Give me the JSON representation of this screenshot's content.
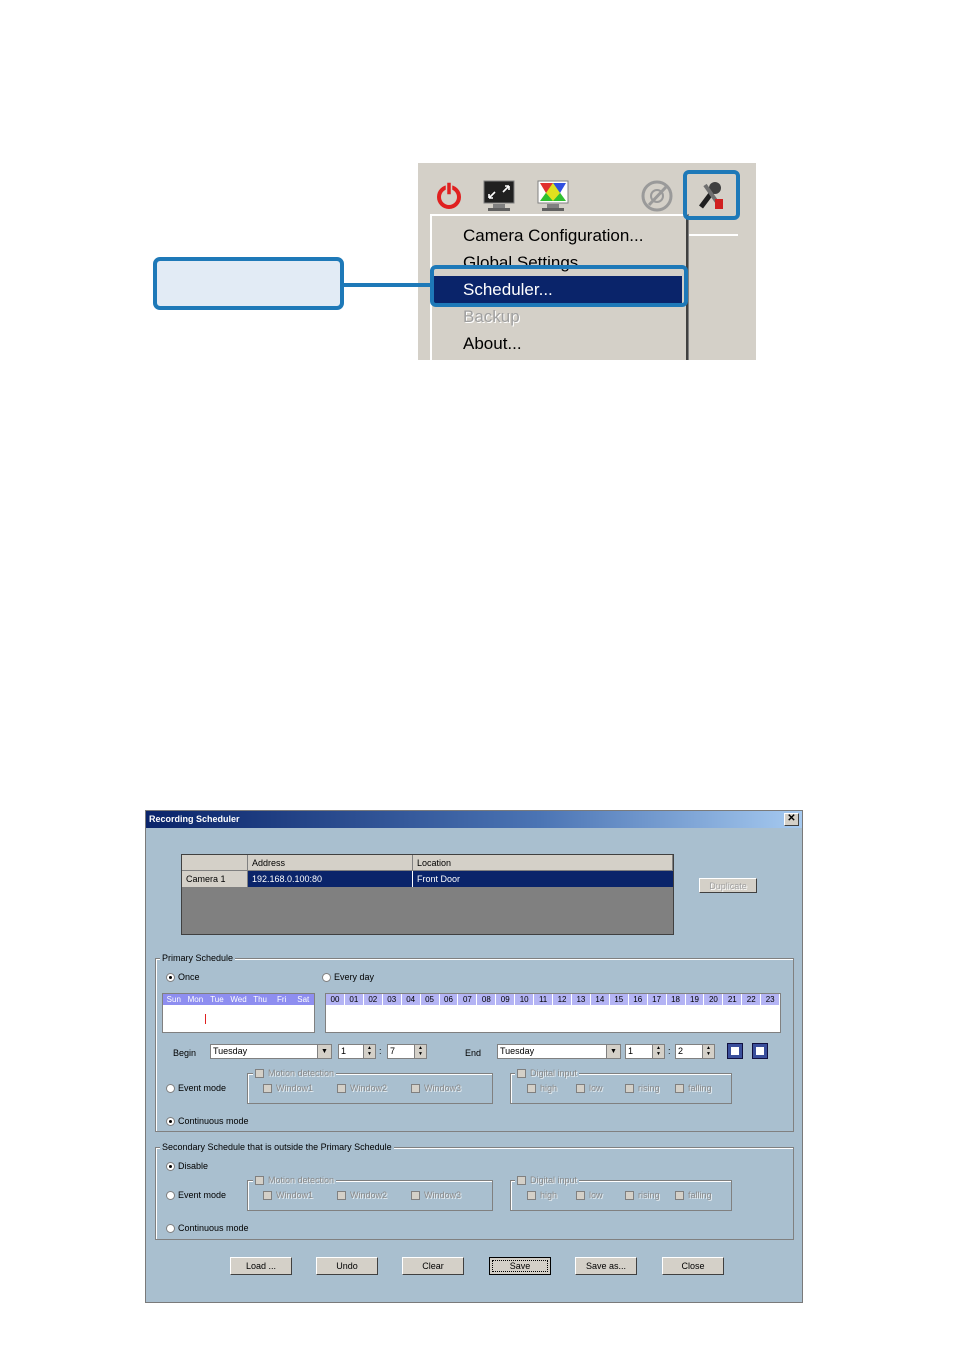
{
  "menu": {
    "items": [
      {
        "label": "Camera Configuration...",
        "state": "normal"
      },
      {
        "label": "Global Settings...",
        "state": "normal"
      },
      {
        "label": "Scheduler...",
        "state": "selected"
      },
      {
        "label": "Backup",
        "state": "disabled"
      },
      {
        "label": "About...",
        "state": "normal"
      }
    ]
  },
  "dialog": {
    "title": "Recording Scheduler",
    "close_glyph": "✕",
    "camera_table": {
      "headers": [
        "",
        "Address",
        "Location"
      ],
      "rows": [
        {
          "name": "Camera  1",
          "address": "192.168.0.100:80",
          "location": "Front Door"
        }
      ]
    },
    "duplicate_label": "Duplicate",
    "primary": {
      "title": "Primary Schedule",
      "once_label": "Once",
      "everyday_label": "Every day",
      "days": [
        "Sun",
        "Mon",
        "Tue",
        "Wed",
        "Thu",
        "Fri",
        "Sat"
      ],
      "hours": [
        "00",
        "01",
        "02",
        "03",
        "04",
        "05",
        "06",
        "07",
        "08",
        "09",
        "10",
        "11",
        "12",
        "13",
        "14",
        "15",
        "16",
        "17",
        "18",
        "19",
        "20",
        "21",
        "22",
        "23"
      ],
      "begin_label": "Begin",
      "begin_day": "Tuesday",
      "begin_hour": "1",
      "begin_min": "7",
      "end_label": "End",
      "end_day": "Tuesday",
      "end_hour": "1",
      "end_min": "2",
      "colon": ":",
      "event_mode_label": "Event mode",
      "continuous_mode_label": "Continuous mode",
      "motion_label": "Motion detection",
      "windows": [
        "Window1",
        "Window2",
        "Window3"
      ],
      "digital_label": "Digital input",
      "digital_opts": [
        "high",
        "low",
        "rising",
        "falling"
      ]
    },
    "secondary": {
      "title": "Secondary Schedule that is outside the Primary Schedule",
      "disable_label": "Disable",
      "event_mode_label": "Event mode",
      "continuous_mode_label": "Continuous mode",
      "motion_label": "Motion detection",
      "windows": [
        "Window1",
        "Window2",
        "Window3"
      ],
      "digital_label": "Digital input",
      "digital_opts": [
        "high",
        "low",
        "rising",
        "falling"
      ]
    },
    "buttons": [
      "Load ...",
      "Undo",
      "Clear",
      "Save",
      "Save as...",
      "Close"
    ]
  },
  "colors": {
    "accent": "#1e79b8",
    "menu_highlight": "#0a246a",
    "dialog_bg": "#a9bfcf"
  }
}
